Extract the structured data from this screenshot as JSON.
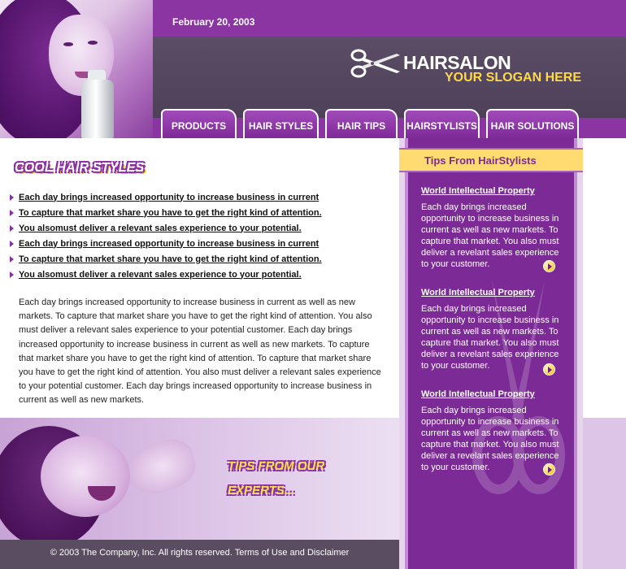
{
  "header": {
    "date": "February 20, 2003",
    "brand": "HAIRSALON",
    "slogan": "YOUR SLOGAN HERE",
    "icon": "scissors-icon"
  },
  "nav": {
    "items": [
      "PRODUCTS",
      "HAIR STYLES",
      "HAIR TIPS",
      "HAIRSTYLISTS",
      "HAIR SOLUTIONS"
    ]
  },
  "main": {
    "title": "COOL HAIR STYLES",
    "links": [
      "Each day brings increased opportunity to increase business in current",
      "To capture that market share you have to get the right kind of attention.",
      "You alsomust deliver a relevant sales experience to your potential.",
      "Each day brings increased opportunity to increase business in current",
      "To capture that market share you have to get the right kind of attention.",
      "You alsomust deliver a relevant sales experience to your potential."
    ],
    "body": "Each day brings increased opportunity to increase business in current as well as new markets. To capture that market share you have to get the right kind of attention. You also must deliver a relevant sales experience to your potential customer. Each day brings increased opportunity to increase business in current as well as new markets. To capture that market share you have to get the right kind of attention. To capture that market share you have to get the right kind of attention. You also must deliver a relevant sales experience to your potential customer. Each day brings increased opportunity to increase business in current as well as new markets."
  },
  "promo": {
    "line1": "TIPS FROM OUR",
    "line2": "EXPERTS..."
  },
  "sidebar": {
    "title": "Tips From HairStylists",
    "tips": [
      {
        "title": "World Intellectual Property",
        "text": "Each day brings increased opportunity to increase business in current as well as new markets. To capture that market. You also must deliver a revelant sales experience to your customer."
      },
      {
        "title": "World Intellectual Property",
        "text": "Each day brings increased opportunity to increase business in current as well as new markets. To capture that market. You also must deliver a revelant sales experience to your customer."
      },
      {
        "title": "World Intellectual Property",
        "text": "Each day brings increased opportunity to increase business in current as well as new markets. To capture that market. You also must deliver a revelant sales experience to your customer."
      }
    ]
  },
  "footer": {
    "copyright": "© 2003 The Company, Inc. All rights reserved.",
    "links": "Terms of Use and Disclaimer"
  },
  "colors": {
    "brand_purple": "#8a35a2",
    "accent_yellow": "#ffd84a",
    "header_gray": "#4a3d55"
  }
}
